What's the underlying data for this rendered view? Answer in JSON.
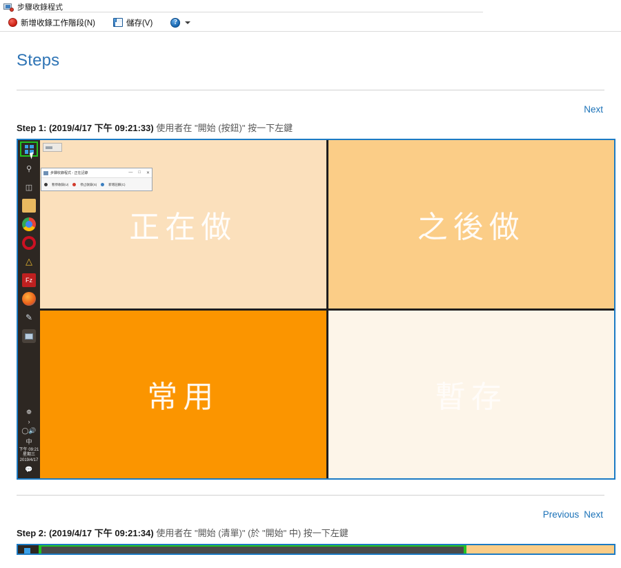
{
  "window": {
    "title": "步驟收錄程式",
    "icon": "steps-recorder-icon"
  },
  "toolbar": {
    "new_session": {
      "label": "新增收錄工作階段(N)",
      "accesskey": "N",
      "icon": "record-icon"
    },
    "save": {
      "label": "儲存(V)",
      "accesskey": "V",
      "icon": "save-icon"
    },
    "help": {
      "label": "?",
      "icon": "help-icon"
    },
    "help_caret": {
      "icon": "chevron-down-icon"
    }
  },
  "document": {
    "heading": "Steps",
    "steps": [
      {
        "nav": {
          "previous": "",
          "next": "Next"
        },
        "prefix": "Step 1:",
        "timestamp": "(2019/4/17 下午 09:21:33)",
        "action": "使用者在 \"開始 (按鈕)\" 按一下左鍵",
        "screenshot": {
          "wallpaper_quadrants": [
            {
              "label": "正在做",
              "color": "#fbe0bc"
            },
            {
              "label": "之後做",
              "color": "#fbcd87"
            },
            {
              "label": "常用",
              "color": "#fb9500"
            },
            {
              "label": "暫存",
              "color": "#fdf5e9"
            }
          ],
          "taskbar": {
            "orientation": "vertical",
            "background": "#2d2722",
            "highlight_color": "#22c322",
            "start_button": "windows-start-icon",
            "items": [
              "search-icon",
              "task-view-icon",
              "file-explorer-icon",
              "chrome-icon",
              "opera-icon",
              "notepadpp-icon",
              "filezilla-icon",
              "firefox-icon",
              "paint-icon",
              "steps-recorder-icon"
            ],
            "tray": {
              "icons": [
                "bluetooth-icon",
                "overflow-chevron-icon",
                "network-icon",
                "volume-icon",
                "ime-icon"
              ],
              "ime": "中",
              "clock_time": "下午 09:21",
              "clock_day": "星期三",
              "clock_date": "2019/4/17",
              "show_desktop": "action-center-icon"
            }
          },
          "recorder_window": {
            "title": "步驟收錄程式 - 正在記錄",
            "buttons": [
              "暫停收錄(U)",
              "停止收錄(S)",
              "新增註解(C)"
            ],
            "window_controls": [
              "—",
              "□",
              "✕"
            ]
          }
        }
      },
      {
        "nav": {
          "previous": "Previous",
          "next": "Next"
        },
        "prefix": "Step 2:",
        "timestamp": "(2019/4/17 下午 09:21:34)",
        "action": "使用者在 \"開始 (清單)\" (於 \"開始\" 中) 按一下左鍵"
      }
    ]
  },
  "colors": {
    "heading": "#2e74b5",
    "link": "#1b72b8",
    "capture_border": "#1b7ac4",
    "highlight": "#22c322",
    "taskbar": "#2d2722"
  }
}
